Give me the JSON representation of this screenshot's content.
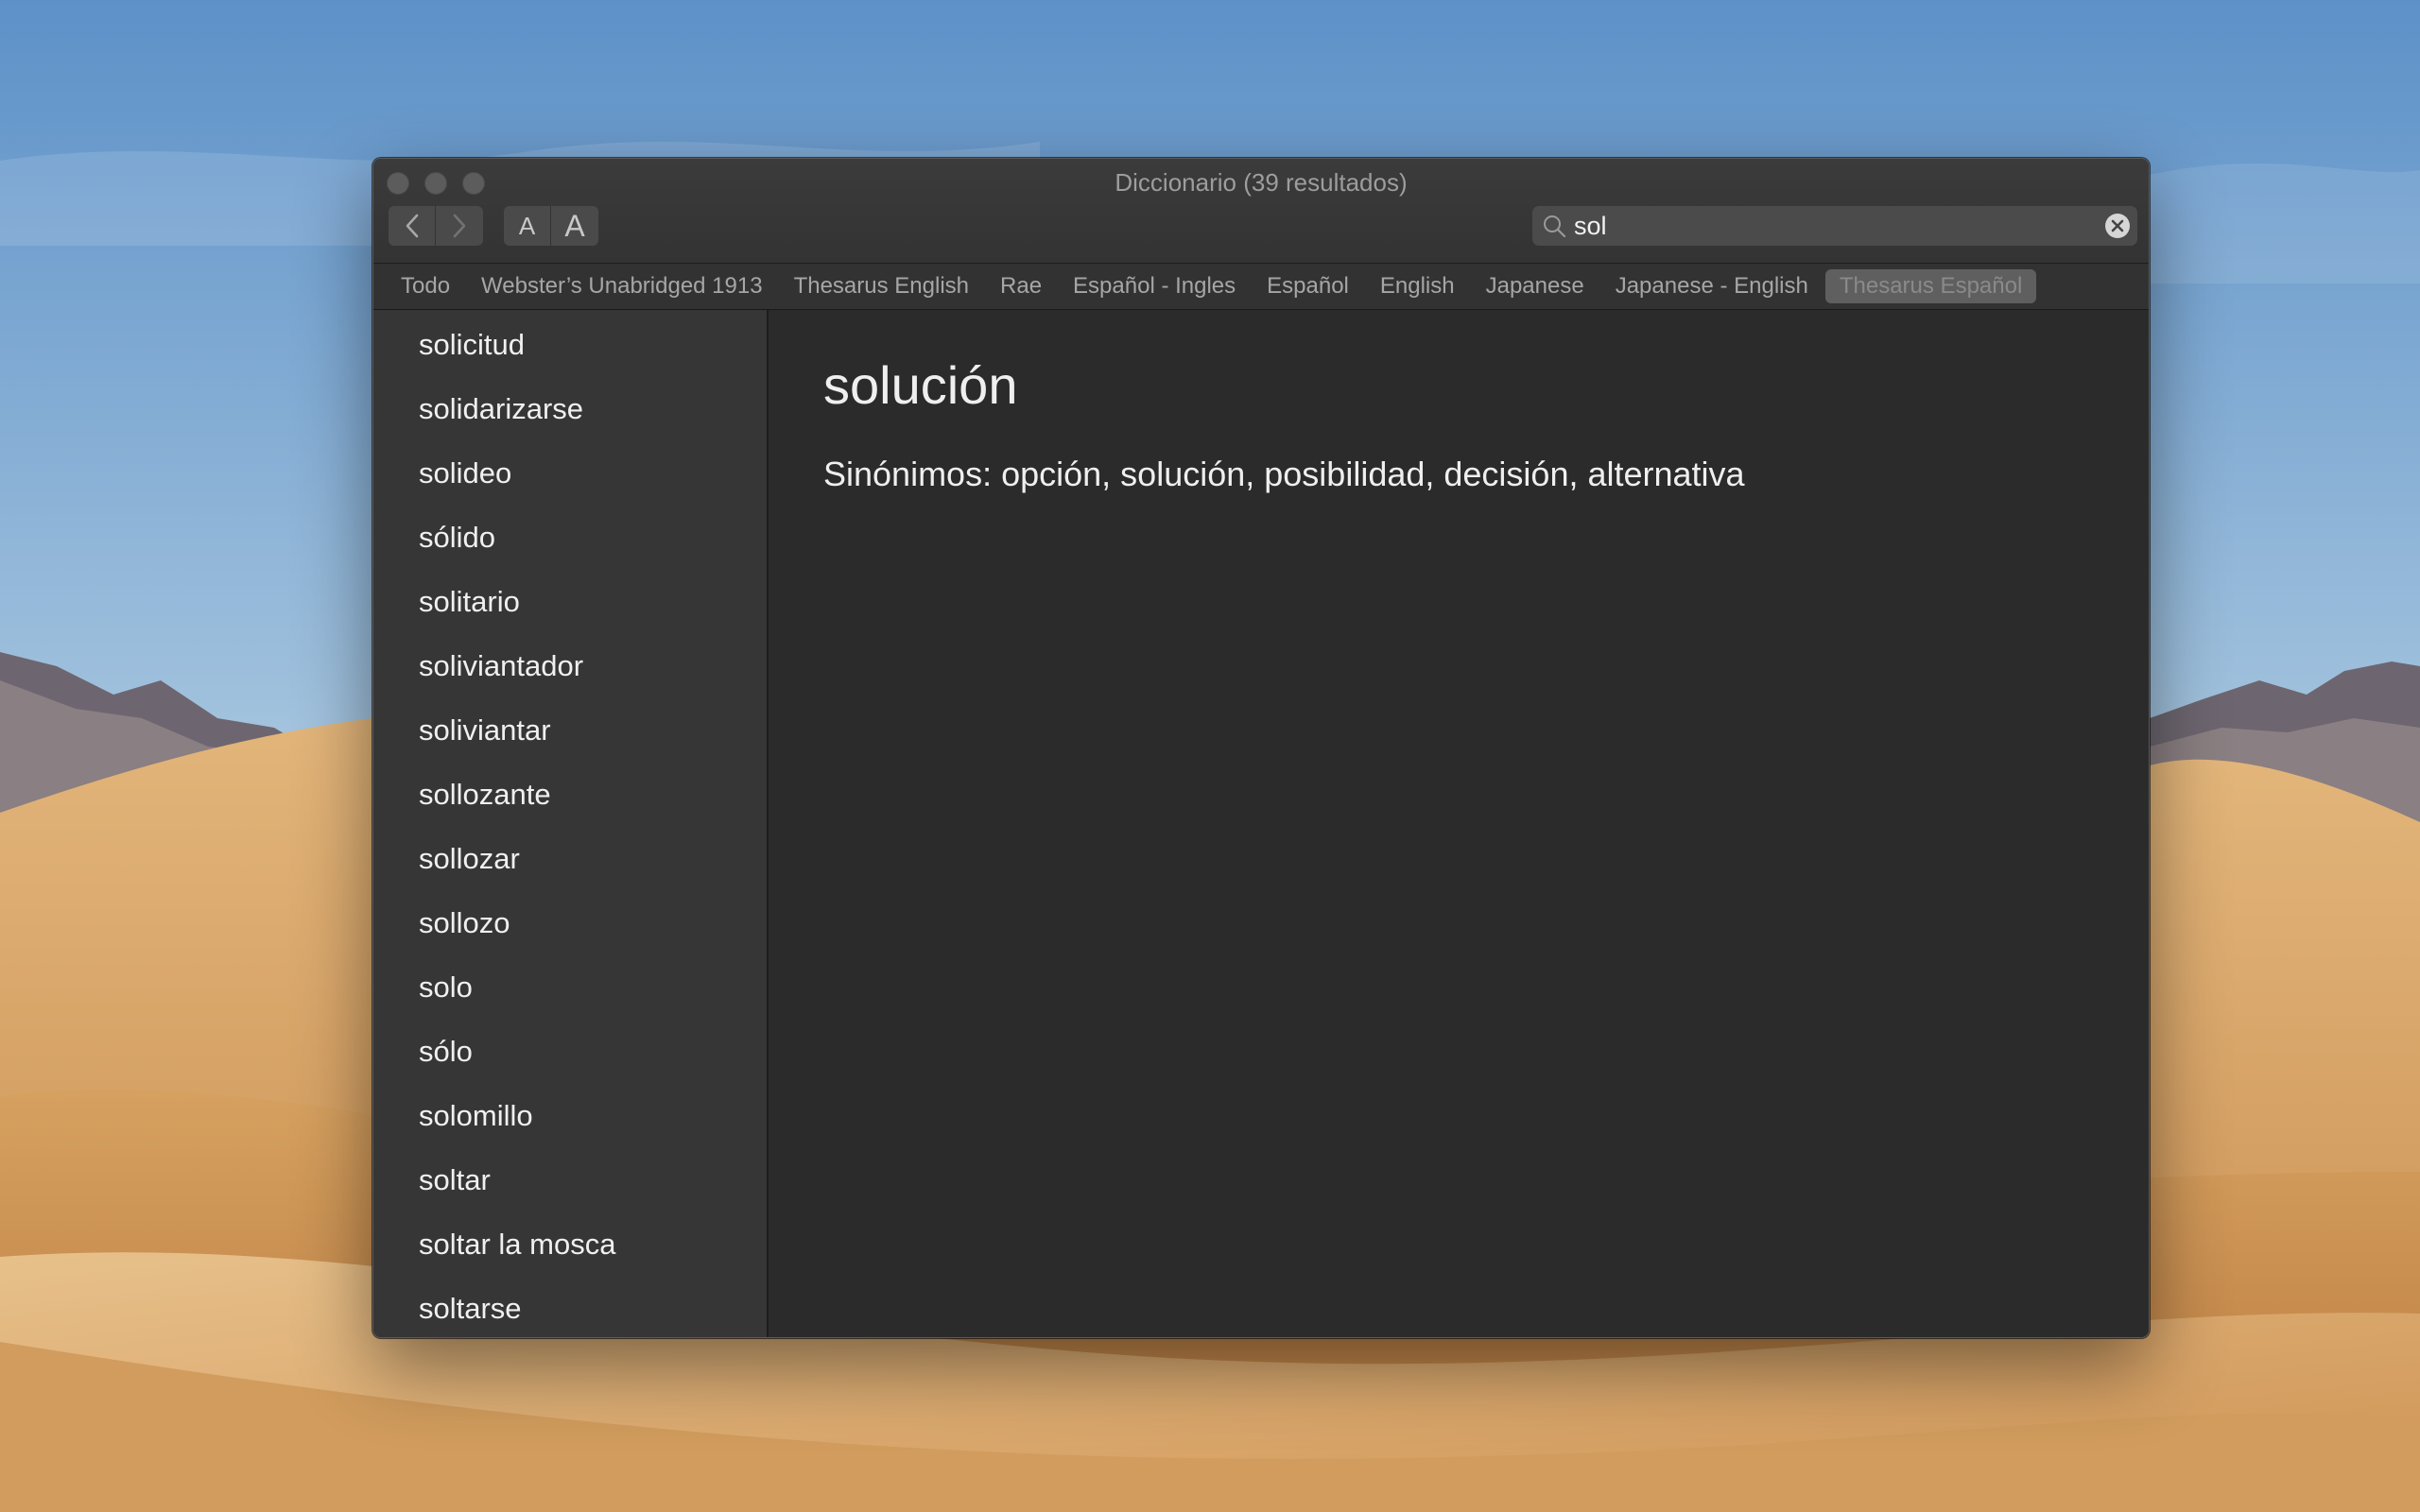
{
  "window": {
    "title": "Diccionario (39 resultados)"
  },
  "toolbar": {
    "back_icon": "chevron-left-icon",
    "forward_icon": "chevron-right-icon",
    "font_smaller_label": "A",
    "font_larger_label": "A"
  },
  "search": {
    "value": "sol",
    "icon": "magnifying-glass-icon",
    "clear_icon": "clear-circle-x-icon"
  },
  "tabs": [
    {
      "label": "Todo",
      "active": false
    },
    {
      "label": "Webster’s Unabridged 1913",
      "active": false
    },
    {
      "label": "Thesarus English",
      "active": false
    },
    {
      "label": "Rae",
      "active": false
    },
    {
      "label": "Español - Ingles",
      "active": false
    },
    {
      "label": "Español",
      "active": false
    },
    {
      "label": "English",
      "active": false
    },
    {
      "label": "Japanese",
      "active": false
    },
    {
      "label": "Japanese - English",
      "active": false
    },
    {
      "label": "Thesarus Español",
      "active": true
    }
  ],
  "results": [
    "solicitud",
    "solidarizarse",
    "solideo",
    "sólido",
    "solitario",
    "soliviantador",
    "soliviantar",
    "sollozante",
    "sollozar",
    "sollozo",
    "solo",
    "sólo",
    "solomillo",
    "soltar",
    "soltar la mosca",
    "soltarse"
  ],
  "entry": {
    "headword": "solución",
    "definition": "Sinónimos: opción, solución, posibilidad, decisión, alternativa"
  }
}
